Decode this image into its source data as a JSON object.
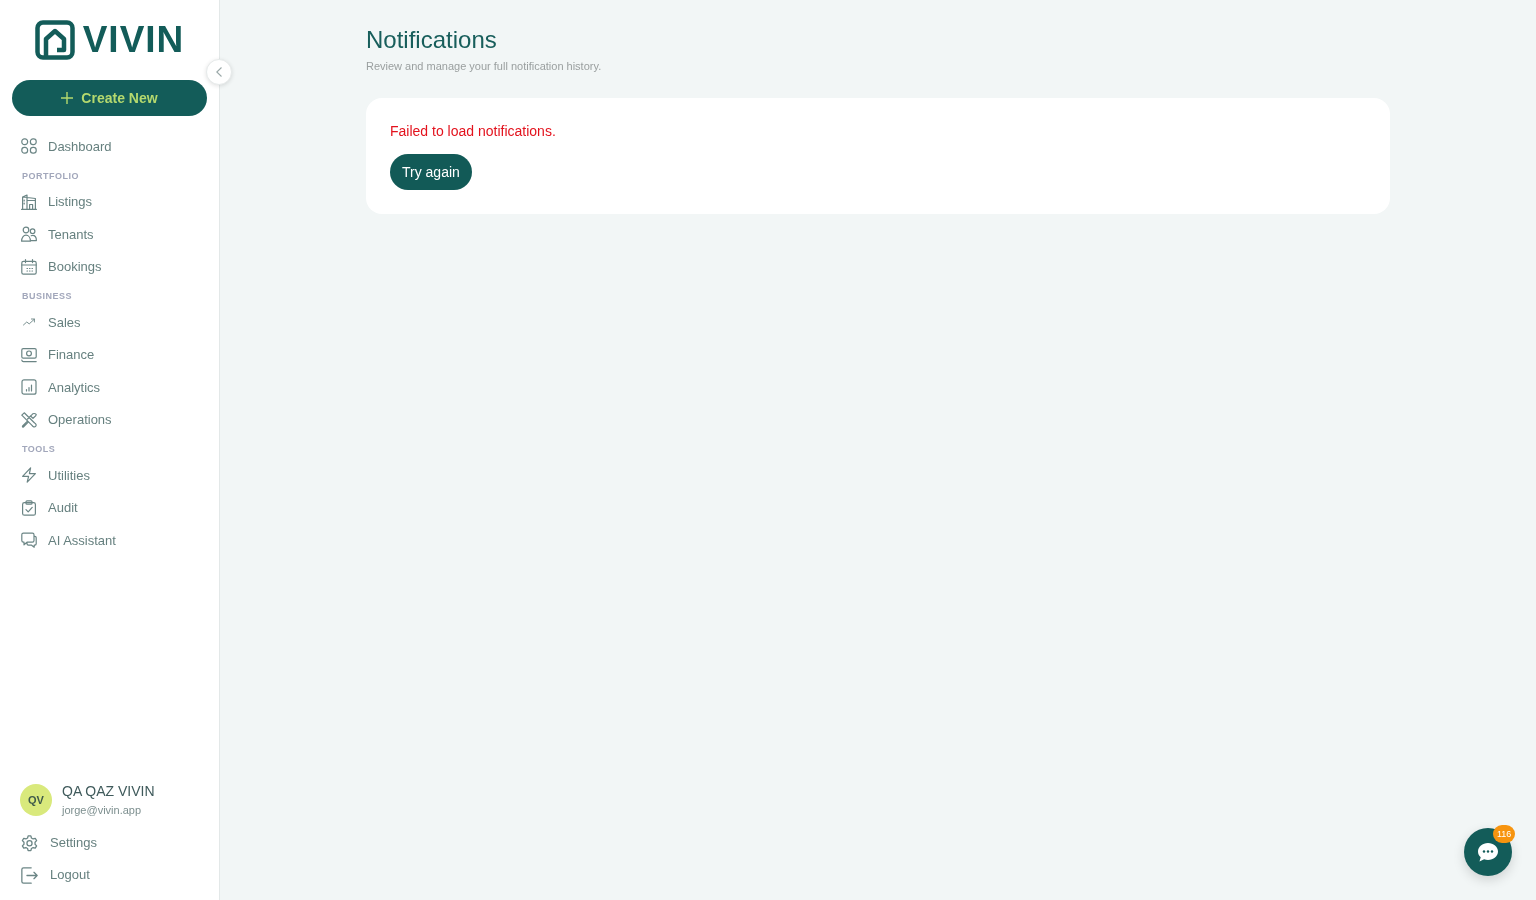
{
  "sidebar": {
    "logo": "VIVIN",
    "create_button": "Create New",
    "nav_sections": [
      {
        "items": [
          {
            "label": "Dashboard",
            "selected": false
          }
        ]
      },
      {
        "heading": "PORTFOLIO",
        "items": [
          {
            "label": "Listings",
            "selected": false
          },
          {
            "label": "Tenants",
            "selected": false
          },
          {
            "label": "Bookings",
            "selected": false
          }
        ]
      },
      {
        "heading": "BUSINESS",
        "items": [
          {
            "label": "Sales",
            "selected": false
          },
          {
            "label": "Finance",
            "selected": false
          },
          {
            "label": "Analytics",
            "selected": false
          },
          {
            "label": "Operations",
            "selected": false
          }
        ]
      },
      {
        "heading": "TOOLS",
        "items": [
          {
            "label": "Utilities",
            "selected": false
          },
          {
            "label": "Audit",
            "selected": false
          },
          {
            "label": "AI Assistant",
            "selected": false
          }
        ]
      }
    ],
    "user": {
      "initials": "QV",
      "name": "QA QAZ VIVIN",
      "email": "jorge@vivin.app"
    },
    "footer_links": [
      {
        "label": "Settings"
      },
      {
        "label": "Logout"
      }
    ]
  },
  "page": {
    "title": "Notifications",
    "subtitle": "Review and manage your full notification history."
  },
  "error_card": {
    "message": "Failed to load notifications.",
    "retry_button": "Try again"
  },
  "chat_button": {
    "badge": "116"
  }
}
